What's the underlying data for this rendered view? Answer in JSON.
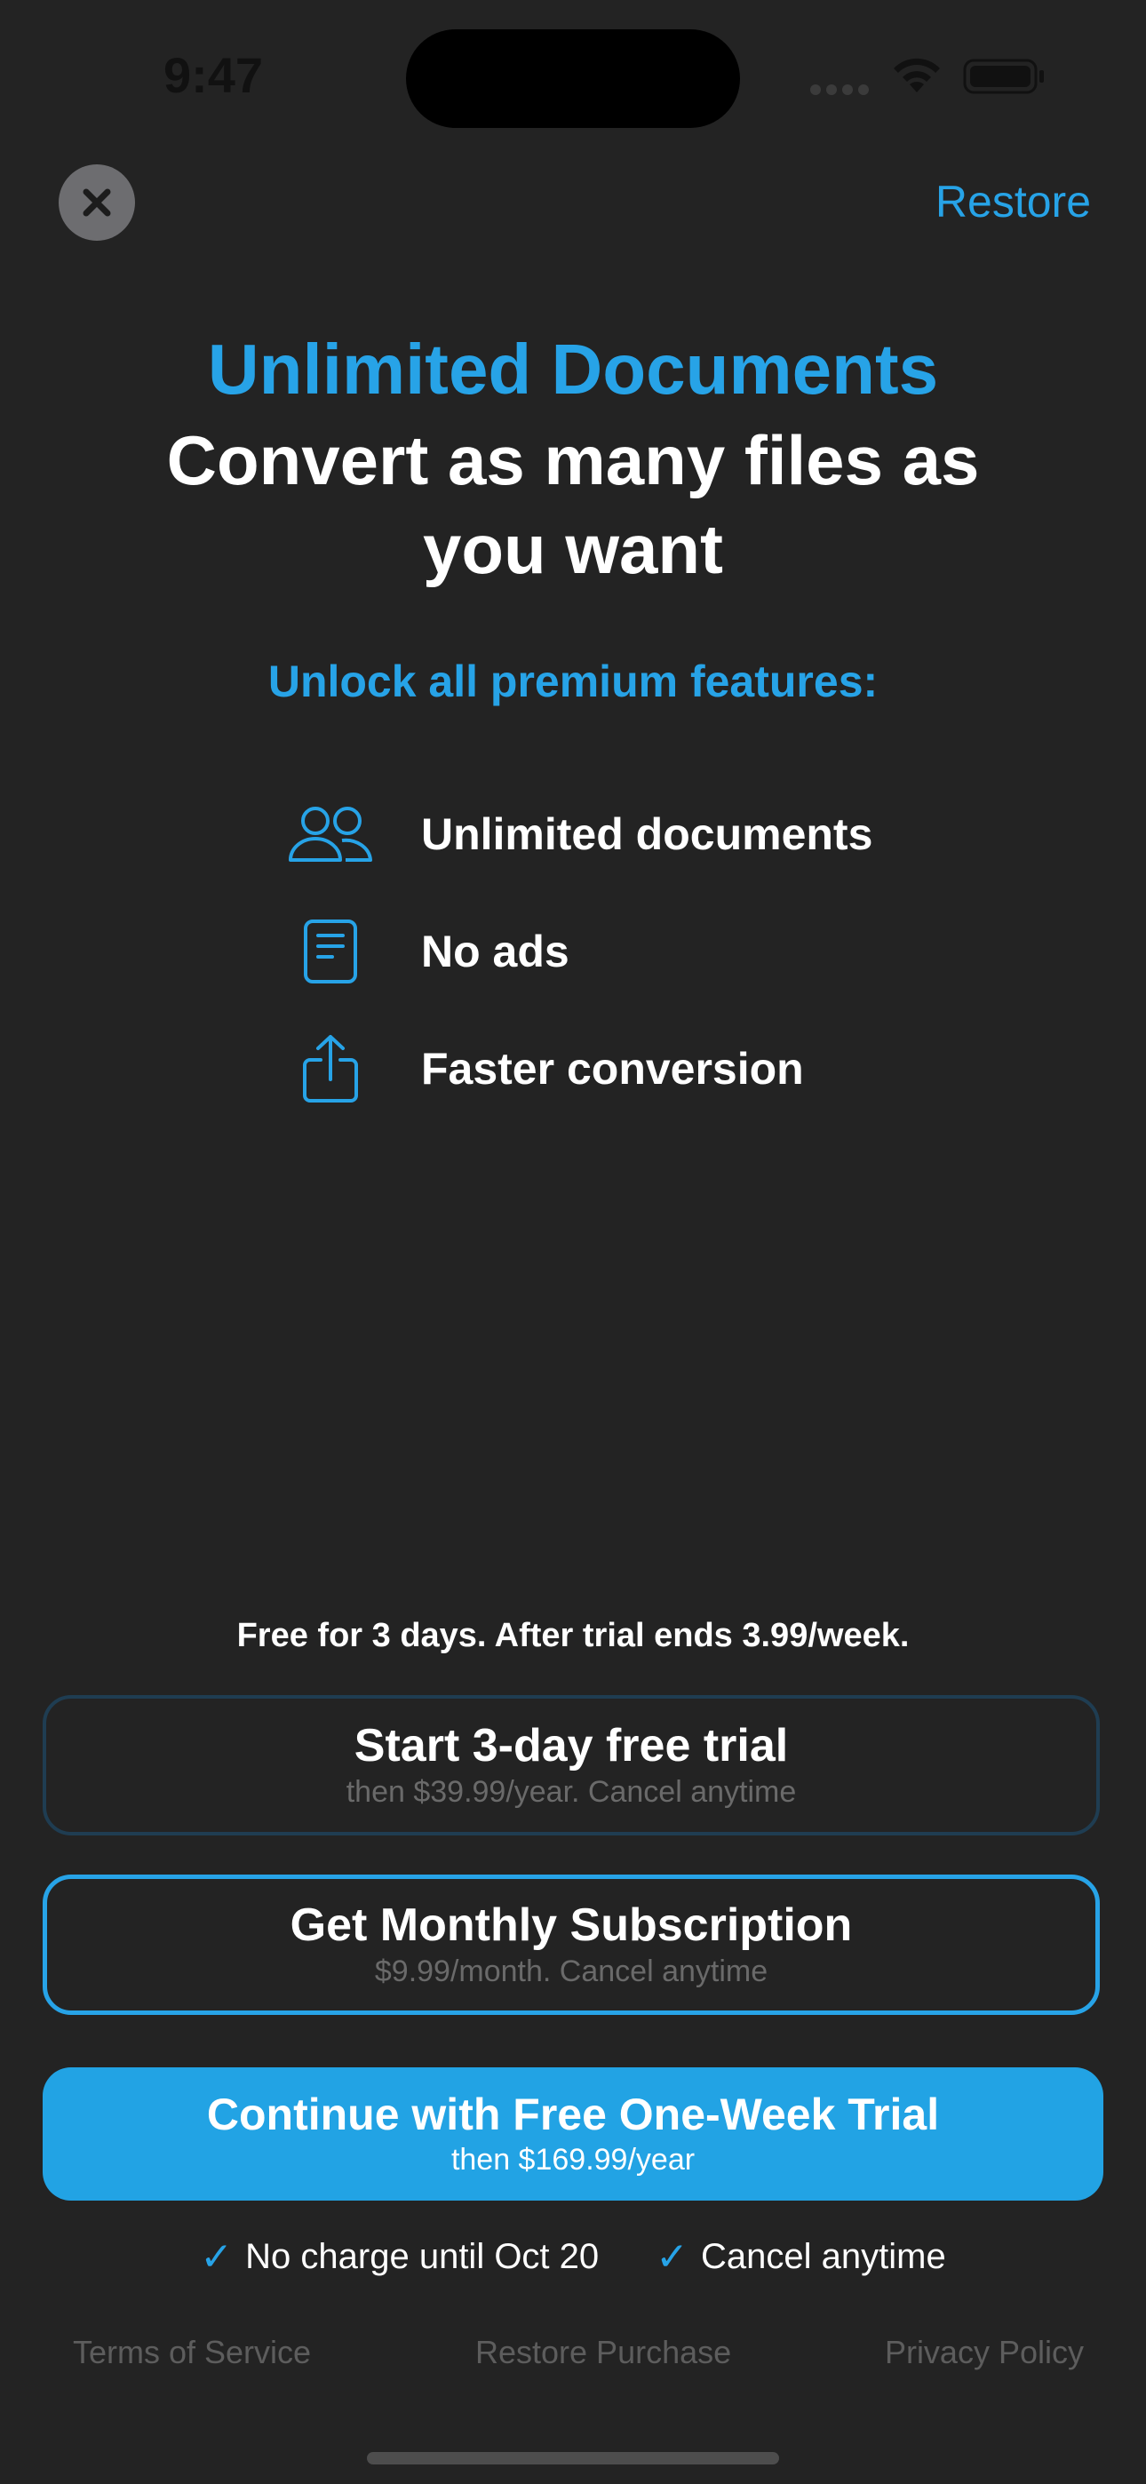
{
  "status_bar": {
    "time": "9:47"
  },
  "header": {
    "restore_label": "Restore",
    "close_icon": "close-icon"
  },
  "headline": {
    "title": "Unlimited Documents",
    "subtitle": "Convert as many files as you want"
  },
  "features": {
    "heading": "Unlock all premium features:",
    "items": [
      {
        "label": "Unlimited documents",
        "icon": "users-icon"
      },
      {
        "label": "No ads",
        "icon": "document-icon"
      },
      {
        "label": "Faster conversion",
        "icon": "share-icon"
      }
    ]
  },
  "trial_note": "Free for 3 days. After trial ends 3.99/week.",
  "plans": [
    {
      "title": "Start 3-day free trial",
      "subtitle": "then $39.99/year. Cancel anytime"
    },
    {
      "title": "Get Monthly Subscription",
      "subtitle": "$9.99/month. Cancel anytime"
    }
  ],
  "cta": {
    "title": "Continue with Free One-Week Trial",
    "subtitle": "then $169.99/year"
  },
  "assurances": [
    {
      "mark": "✓",
      "label": "No charge until Oct 20"
    },
    {
      "mark": "✓",
      "label": "Cancel anytime"
    }
  ],
  "footer": {
    "terms": "Terms of Service",
    "restore_purchase": "Restore Purchase",
    "privacy": "Privacy Policy"
  },
  "colors": {
    "background": "#232323",
    "accent": "#27a3e7",
    "cta": "#22a3e4"
  }
}
